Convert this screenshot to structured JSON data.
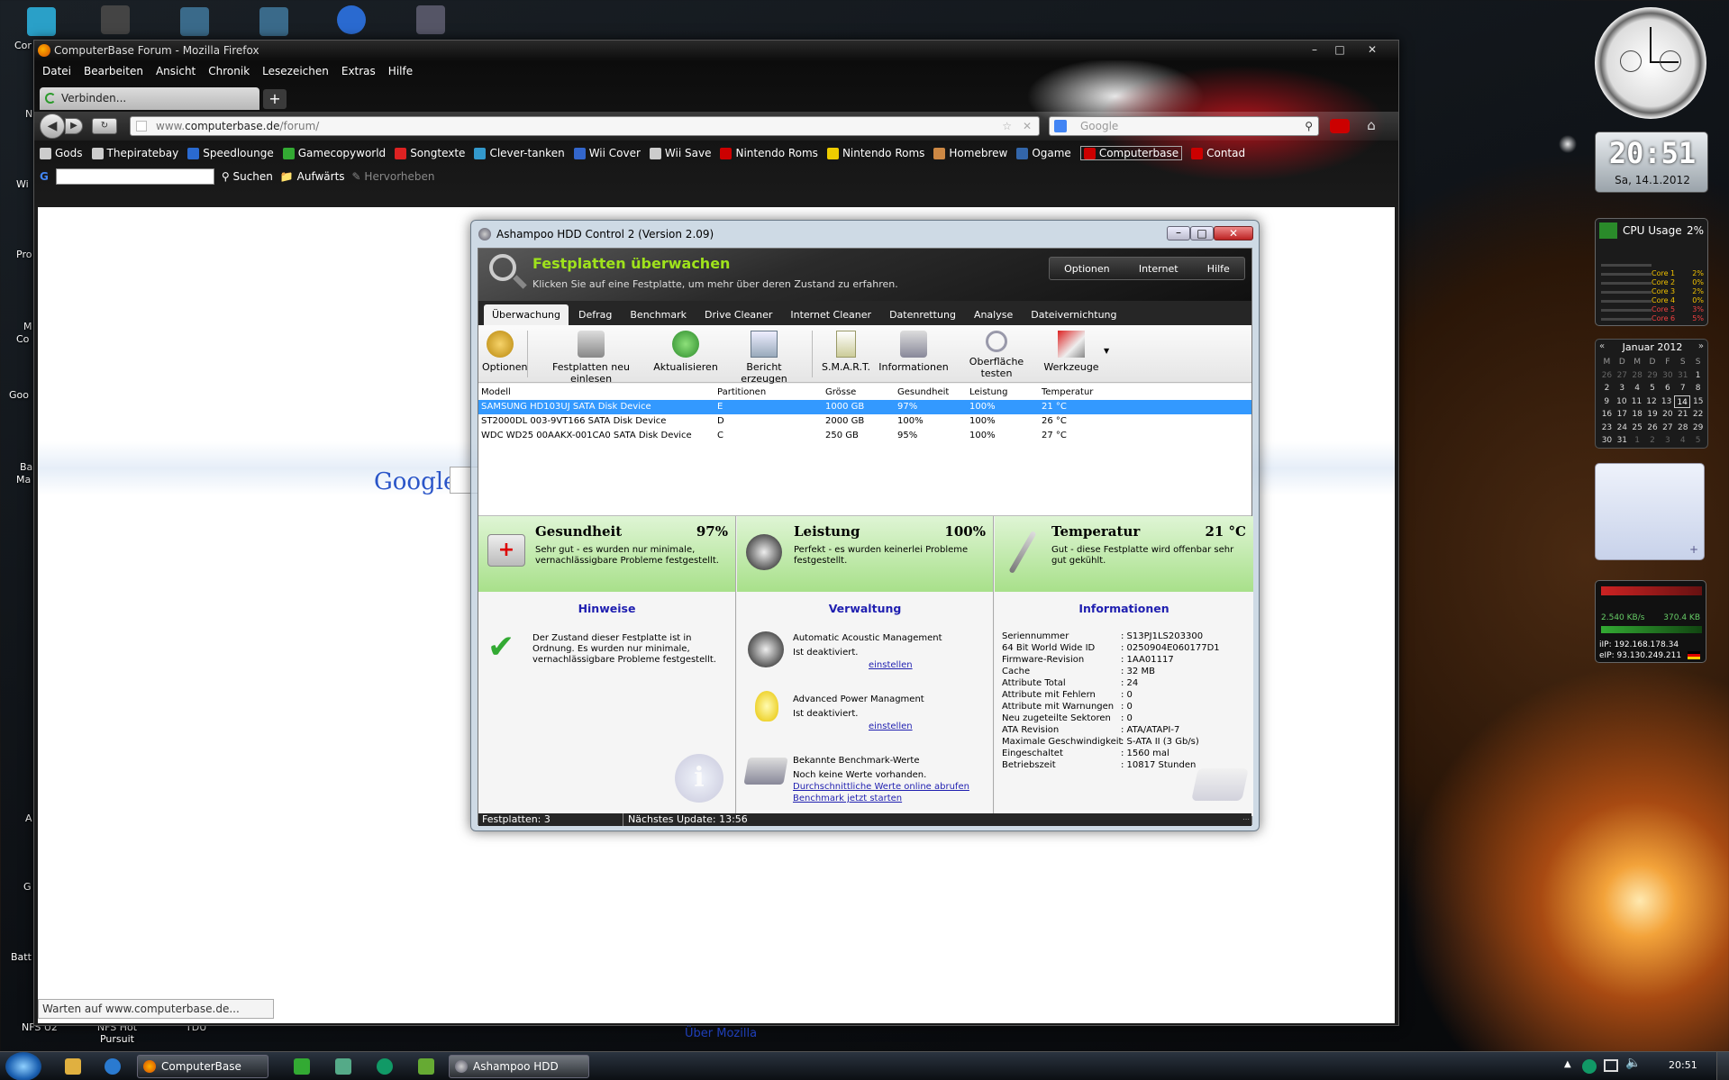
{
  "desktop": {
    "top_icon_label": "Cor",
    "left_labels": [
      "N",
      "Wi",
      "Pro",
      "M",
      "Co",
      "Goo",
      "Ba",
      "Ma",
      "A",
      "G",
      "Batt"
    ],
    "bottom_labels": [
      "NFS U2",
      "NFS Hot Pursuit",
      "TDU"
    ]
  },
  "firefox": {
    "title": "ComputerBase Forum - Mozilla Firefox",
    "menu": [
      "Datei",
      "Bearbeiten",
      "Ansicht",
      "Chronik",
      "Lesezeichen",
      "Extras",
      "Hilfe"
    ],
    "tab_label": "Verbinden...",
    "url_prefix": "www.",
    "url_host": "computerbase.de",
    "url_path": "/forum/",
    "search_placeholder": "Google",
    "bookmarks": [
      "Gods",
      "Thepiratebay",
      "Speedlounge",
      "Gamecopyworld",
      "Songtexte",
      "Clever-tanken",
      "Wii Cover",
      "Wii Save",
      "Nintendo Roms",
      "Nintendo Roms",
      "Homebrew",
      "Ogame",
      "Computerbase",
      "Contad"
    ],
    "gbar": {
      "search": "Suchen",
      "up": "Aufwärts",
      "highlight": "Hervorheben"
    },
    "google_logo": "Google",
    "about_link": "Über Mozilla",
    "status": "Warten auf www.computerbase.de..."
  },
  "hdd": {
    "title": "Ashampoo HDD Control 2 (Version 2.09)",
    "header": {
      "title": "Festplatten überwachen",
      "subtitle": "Klicken Sie auf eine Festplatte, um mehr über deren Zustand zu erfahren.",
      "buttons": [
        "Optionen",
        "Internet",
        "Hilfe"
      ]
    },
    "tabs": [
      "Überwachung",
      "Defrag",
      "Benchmark",
      "Drive Cleaner",
      "Internet Cleaner",
      "Datenrettung",
      "Analyse",
      "Dateivernichtung"
    ],
    "toolbar": [
      "Optionen",
      "Festplatten neu einlesen",
      "Aktualisieren",
      "Bericht erzeugen",
      "S.M.A.R.T.",
      "Informationen",
      "Oberfläche testen",
      "Werkzeuge"
    ],
    "columns": [
      "Modell",
      "Partitionen",
      "Grösse",
      "Gesundheit",
      "Leistung",
      "Temperatur"
    ],
    "rows": [
      [
        "SAMSUNG HD103UJ SATA Disk Device",
        "E",
        "1000 GB",
        "97%",
        "100%",
        "21 °C"
      ],
      [
        "ST2000DL 003-9VT166 SATA Disk Device",
        "D",
        "2000 GB",
        "100%",
        "100%",
        "26 °C"
      ],
      [
        "WDC WD25 00AAKX-001CA0 SATA Disk Device",
        "C",
        "250 GB",
        "95%",
        "100%",
        "27 °C"
      ]
    ],
    "health": {
      "title": "Gesundheit",
      "value": "97%",
      "desc": "Sehr gut - es wurden nur minimale, vernachlässigbare Probleme festgestellt."
    },
    "performance": {
      "title": "Leistung",
      "value": "100%",
      "desc": "Perfekt - es wurden keinerlei Probleme festgestellt."
    },
    "temperature": {
      "title": "Temperatur",
      "value": "21 °C",
      "desc": "Gut - diese Festplatte wird offenbar sehr gut gekühlt."
    },
    "hints": {
      "title": "Hinweise",
      "text": "Der Zustand dieser Festplatte ist in Ordnung. Es wurden nur minimale, vernachlässigbare Probleme festgestellt."
    },
    "management": {
      "title": "Verwaltung",
      "aam_title": "Automatic Acoustic Management",
      "aam_state": "Ist deaktiviert.",
      "aam_link": "einstellen",
      "apm_title": "Advanced Power Managment",
      "apm_state": "Ist deaktiviert.",
      "apm_link": "einstellen",
      "bench_title": "Bekannte Benchmark-Werte",
      "bench_state": "Noch keine Werte vorhanden.",
      "bench_link1": "Durchschnittliche Werte online abrufen",
      "bench_link2": "Benchmark jetzt starten"
    },
    "info": {
      "title": "Informationen",
      "items": [
        [
          "Seriennummer",
          ": S13PJ1LS203300"
        ],
        [
          "64 Bit World Wide ID",
          ": 0250904E060177D1"
        ],
        [
          "Firmware-Revision",
          ": 1AA01117"
        ],
        [
          "Cache",
          ": 32 MB"
        ],
        [
          "Attribute Total",
          ": 24"
        ],
        [
          "Attribute mit Fehlern",
          ": 0"
        ],
        [
          "Attribute mit Warnungen",
          ": 0"
        ],
        [
          "Neu zugeteilte Sektoren",
          ": 0"
        ],
        [
          "ATA Revision",
          ": ATA/ATAPI-7"
        ],
        [
          "Maximale Geschwindigkeit",
          ": S-ATA II (3 Gb/s)"
        ],
        [
          "Eingeschaltet",
          ": 1560 mal"
        ],
        [
          "Betriebszeit",
          ": 10817 Stunden"
        ]
      ]
    },
    "status_count": "Festplatten: 3",
    "status_update": "Nächstes Update: 13:56"
  },
  "gadgets": {
    "digital_time": "20:51",
    "date": "Sa, 14.1.2012",
    "cpu_title": "CPU Usage",
    "cpu_value": "2%",
    "cpu_cores": [
      [
        "Core 1",
        "2%"
      ],
      [
        "Core 2",
        "0%"
      ],
      [
        "Core 3",
        "2%"
      ],
      [
        "Core 4",
        "0%"
      ],
      [
        "Core 5",
        "3%"
      ],
      [
        "Core 6",
        "5%"
      ]
    ],
    "calendar_title": "Januar 2012",
    "calendar_days": [
      "M",
      "D",
      "M",
      "D",
      "F",
      "S",
      "S"
    ],
    "calendar_rows": [
      [
        "26",
        "27",
        "28",
        "29",
        "30",
        "31",
        "1"
      ],
      [
        "2",
        "3",
        "4",
        "5",
        "6",
        "7",
        "8"
      ],
      [
        "9",
        "10",
        "11",
        "12",
        "13",
        "14",
        "15"
      ],
      [
        "16",
        "17",
        "18",
        "19",
        "20",
        "21",
        "22"
      ],
      [
        "23",
        "24",
        "25",
        "26",
        "27",
        "28",
        "29"
      ],
      [
        "30",
        "31",
        "1",
        "2",
        "3",
        "4",
        "5"
      ]
    ],
    "net_down": "2.540 KB/s",
    "net_up": "370.4 KB",
    "net_iip": "iIP: 192.168.178.34",
    "net_eip": "eIP: 93.130.249.211"
  },
  "taskbar": {
    "firefox_label": "ComputerBase Foru...",
    "hdd_label": "Ashampoo HDD Con...",
    "clock": "20:51"
  }
}
